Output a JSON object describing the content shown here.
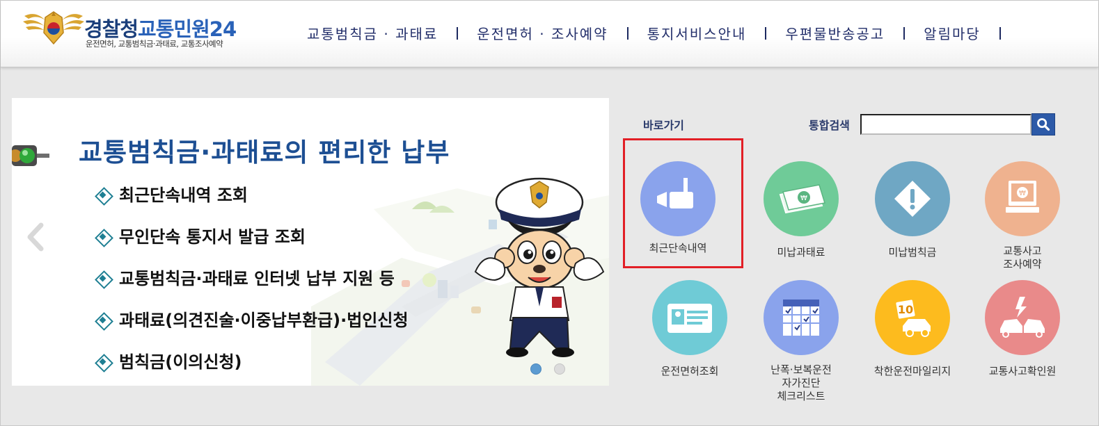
{
  "header": {
    "logo_title_part1": "경찰청",
    "logo_title_part2": "교통민원24",
    "logo_subtitle": "운전면허, 교통범칙금·과태료, 교통조사예약",
    "nav": [
      {
        "label": "교통범칙금 · 과태료"
      },
      {
        "label": "운전면허 · 조사예약"
      },
      {
        "label": "통지서비스안내"
      },
      {
        "label": "우편물반송공고"
      },
      {
        "label": "알림마당"
      }
    ]
  },
  "banner": {
    "title": "교통범칙금·과태료의 편리한 납부",
    "items": [
      "최근단속내역 조회",
      "무인단속 통지서 발급 조회",
      "교통범칙금·과태료 인터넷 납부 지원 등",
      "과태료(의견진술·이중납부환급)·법인신청",
      "범칙금(이의신청)"
    ],
    "slide_count": 2,
    "active_slide": 1
  },
  "shortcuts": {
    "label": "바로가기",
    "items": [
      {
        "label": "최근단속내역",
        "icon": "camera-icon",
        "color": "#8aa3ec"
      },
      {
        "label": "미납과태료",
        "icon": "money-icon",
        "color": "#6fcb98"
      },
      {
        "label": "미납범칙금",
        "icon": "warning-icon",
        "color": "#6fa7c4"
      },
      {
        "label": "교통사고\n조사예약",
        "icon": "computer-icon",
        "color": "#efb28f"
      },
      {
        "label": "운전면허조회",
        "icon": "id-card-icon",
        "color": "#6fcbd6"
      },
      {
        "label": "난폭·보복운전\n자가진단\n체크리스트",
        "icon": "calendar-icon",
        "color": "#8aa3ec"
      },
      {
        "label": "착한운전마일리지",
        "icon": "mileage-car-icon",
        "color": "#fdbb1e"
      },
      {
        "label": "교통사고확인원",
        "icon": "car-crash-icon",
        "color": "#e98a8a"
      }
    ]
  },
  "search": {
    "label": "통합검색",
    "value": ""
  }
}
